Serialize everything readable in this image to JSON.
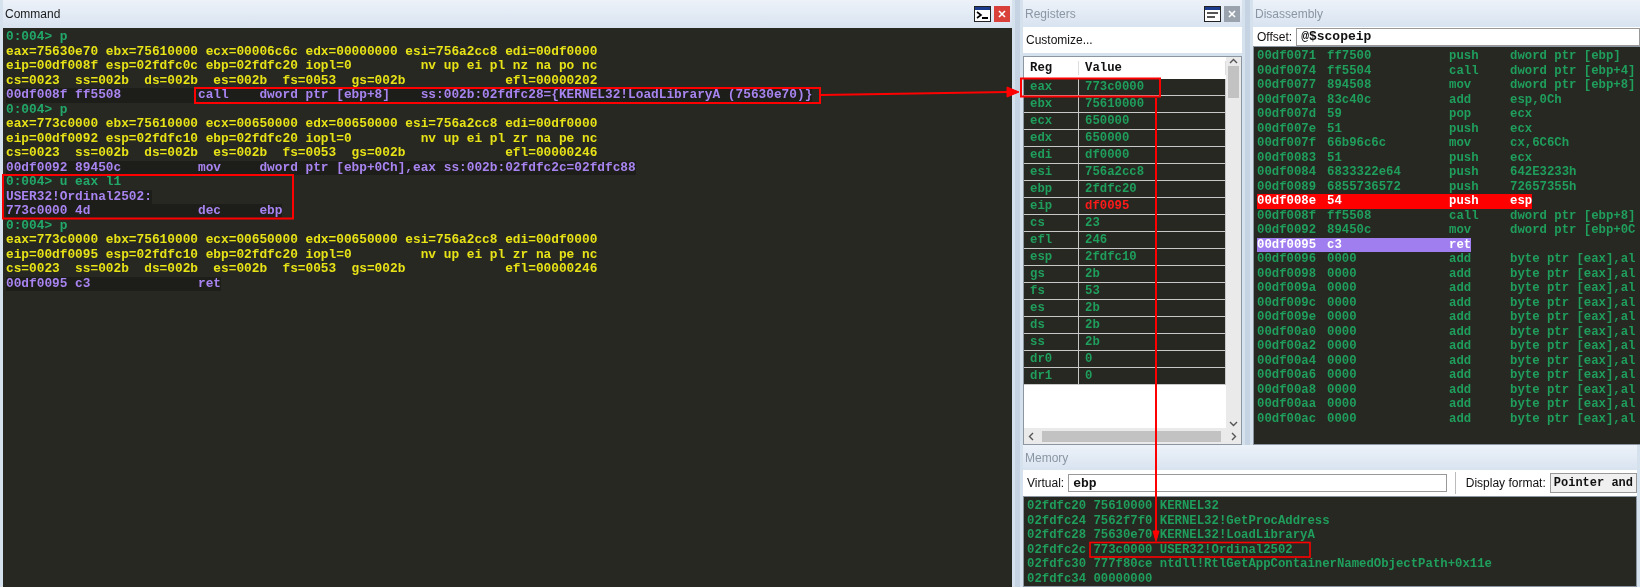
{
  "command": {
    "title": "Command",
    "lines": [
      {
        "kind": "prompt",
        "text": "0:004> p"
      },
      {
        "kind": "regs",
        "text": "eax=75630e70 ebx=75610000 ecx=00006c6c edx=00000000 esi=756a2cc8 edi=00df0000"
      },
      {
        "kind": "regs",
        "text": "eip=00df008f esp=02fdfc0c ebp=02fdfc20 iopl=0         nv up ei pl nz na po nc"
      },
      {
        "kind": "regs",
        "text": "cs=0023  ss=002b  ds=002b  es=002b  fs=0053  gs=002b             efl=00000202"
      },
      {
        "kind": "disasm",
        "text": "00df008f ff5508          call    dword ptr [ebp+8]    ss:002b:02fdfc28={KERNEL32!LoadLibraryA (75630e70)}"
      },
      {
        "kind": "prompt",
        "text": "0:004> p"
      },
      {
        "kind": "regs",
        "text": "eax=773c0000 ebx=75610000 ecx=00650000 edx=00650000 esi=756a2cc8 edi=00df0000"
      },
      {
        "kind": "regs",
        "text": "eip=00df0092 esp=02fdfc10 ebp=02fdfc20 iopl=0         nv up ei pl zr na pe nc"
      },
      {
        "kind": "regs",
        "text": "cs=0023  ss=002b  ds=002b  es=002b  fs=0053  gs=002b             efl=00000246"
      },
      {
        "kind": "disasm",
        "text": "00df0092 89450c          mov     dword ptr [ebp+0Ch],eax ss:002b:02fdfc2c=02fdfc88"
      },
      {
        "kind": "prompt",
        "text": "0:004> u eax l1"
      },
      {
        "kind": "symbol",
        "text": "USER32!Ordinal2502:"
      },
      {
        "kind": "disasm",
        "text": "773c0000 4d              dec     ebp"
      },
      {
        "kind": "prompt",
        "text": "0:004> p"
      },
      {
        "kind": "regs",
        "text": "eax=773c0000 ebx=75610000 ecx=00650000 edx=00650000 esi=756a2cc8 edi=00df0000"
      },
      {
        "kind": "regs",
        "text": "eip=00df0095 esp=02fdfc10 ebp=02fdfc20 iopl=0         nv up ei pl zr na pe nc"
      },
      {
        "kind": "regs",
        "text": "cs=0023  ss=002b  ds=002b  es=002b  fs=0053  gs=002b             efl=00000246"
      },
      {
        "kind": "disasm",
        "text": "00df0095 c3              ret"
      }
    ]
  },
  "registers": {
    "title": "Registers",
    "customize": "Customize...",
    "columns": [
      "Reg",
      "Value"
    ],
    "rows": [
      {
        "reg": "eax",
        "value": "773c0000",
        "changed": false
      },
      {
        "reg": "ebx",
        "value": "75610000",
        "changed": false
      },
      {
        "reg": "ecx",
        "value": "650000",
        "changed": false
      },
      {
        "reg": "edx",
        "value": "650000",
        "changed": false
      },
      {
        "reg": "edi",
        "value": "df0000",
        "changed": false
      },
      {
        "reg": "esi",
        "value": "756a2cc8",
        "changed": false
      },
      {
        "reg": "ebp",
        "value": "2fdfc20",
        "changed": false
      },
      {
        "reg": "eip",
        "value": "df0095",
        "changed": true
      },
      {
        "reg": "cs",
        "value": "23",
        "changed": false
      },
      {
        "reg": "efl",
        "value": "246",
        "changed": false
      },
      {
        "reg": "esp",
        "value": "2fdfc10",
        "changed": false
      },
      {
        "reg": "gs",
        "value": "2b",
        "changed": false
      },
      {
        "reg": "fs",
        "value": "53",
        "changed": false
      },
      {
        "reg": "es",
        "value": "2b",
        "changed": false
      },
      {
        "reg": "ds",
        "value": "2b",
        "changed": false
      },
      {
        "reg": "ss",
        "value": "2b",
        "changed": false
      },
      {
        "reg": "dr0",
        "value": "0",
        "changed": false
      },
      {
        "reg": "dr1",
        "value": "0",
        "changed": false
      }
    ]
  },
  "disassembly": {
    "title": "Disassembly",
    "offset_label": "Offset:",
    "offset": "@$scopeip",
    "rows": [
      {
        "address": "00df0071",
        "bytes": "ff7500",
        "mnemonic": "push",
        "operands": "dword ptr [ebp]",
        "breakpoint": false,
        "current": false
      },
      {
        "address": "00df0074",
        "bytes": "ff5504",
        "mnemonic": "call",
        "operands": "dword ptr [ebp+4]",
        "breakpoint": false,
        "current": false
      },
      {
        "address": "00df0077",
        "bytes": "894508",
        "mnemonic": "mov",
        "operands": "dword ptr [ebp+8]",
        "breakpoint": false,
        "current": false
      },
      {
        "address": "00df007a",
        "bytes": "83c40c",
        "mnemonic": "add",
        "operands": "esp,0Ch",
        "breakpoint": false,
        "current": false
      },
      {
        "address": "00df007d",
        "bytes": "59",
        "mnemonic": "pop",
        "operands": "ecx",
        "breakpoint": false,
        "current": false
      },
      {
        "address": "00df007e",
        "bytes": "51",
        "mnemonic": "push",
        "operands": "ecx",
        "breakpoint": false,
        "current": false
      },
      {
        "address": "00df007f",
        "bytes": "66b96c6c",
        "mnemonic": "mov",
        "operands": "cx,6C6Ch",
        "breakpoint": false,
        "current": false
      },
      {
        "address": "00df0083",
        "bytes": "51",
        "mnemonic": "push",
        "operands": "ecx",
        "breakpoint": false,
        "current": false
      },
      {
        "address": "00df0084",
        "bytes": "6833322e64",
        "mnemonic": "push",
        "operands": "642E3233h",
        "breakpoint": false,
        "current": false
      },
      {
        "address": "00df0089",
        "bytes": "6855736572",
        "mnemonic": "push",
        "operands": "72657355h",
        "breakpoint": false,
        "current": false
      },
      {
        "address": "00df008e",
        "bytes": "54",
        "mnemonic": "push",
        "operands": "esp",
        "breakpoint": true,
        "current": false
      },
      {
        "address": "00df008f",
        "bytes": "ff5508",
        "mnemonic": "call",
        "operands": "dword ptr [ebp+8]",
        "breakpoint": false,
        "current": false
      },
      {
        "address": "00df0092",
        "bytes": "89450c",
        "mnemonic": "mov",
        "operands": "dword ptr [ebp+0C",
        "breakpoint": false,
        "current": false
      },
      {
        "address": "00df0095",
        "bytes": "c3",
        "mnemonic": "ret",
        "breakpoint": false,
        "current": true
      },
      {
        "address": "00df0096",
        "bytes": "0000",
        "mnemonic": "add",
        "operands": "byte ptr [eax],al",
        "breakpoint": false,
        "current": false
      },
      {
        "address": "00df0098",
        "bytes": "0000",
        "mnemonic": "add",
        "operands": "byte ptr [eax],al",
        "breakpoint": false,
        "current": false
      },
      {
        "address": "00df009a",
        "bytes": "0000",
        "mnemonic": "add",
        "operands": "byte ptr [eax],al",
        "breakpoint": false,
        "current": false
      },
      {
        "address": "00df009c",
        "bytes": "0000",
        "mnemonic": "add",
        "operands": "byte ptr [eax],al",
        "breakpoint": false,
        "current": false
      },
      {
        "address": "00df009e",
        "bytes": "0000",
        "mnemonic": "add",
        "operands": "byte ptr [eax],al",
        "breakpoint": false,
        "current": false
      },
      {
        "address": "00df00a0",
        "bytes": "0000",
        "mnemonic": "add",
        "operands": "byte ptr [eax],al",
        "breakpoint": false,
        "current": false
      },
      {
        "address": "00df00a2",
        "bytes": "0000",
        "mnemonic": "add",
        "operands": "byte ptr [eax],al",
        "breakpoint": false,
        "current": false
      },
      {
        "address": "00df00a4",
        "bytes": "0000",
        "mnemonic": "add",
        "operands": "byte ptr [eax],al",
        "breakpoint": false,
        "current": false
      },
      {
        "address": "00df00a6",
        "bytes": "0000",
        "mnemonic": "add",
        "operands": "byte ptr [eax],al",
        "breakpoint": false,
        "current": false
      },
      {
        "address": "00df00a8",
        "bytes": "0000",
        "mnemonic": "add",
        "operands": "byte ptr [eax],al",
        "breakpoint": false,
        "current": false
      },
      {
        "address": "00df00aa",
        "bytes": "0000",
        "mnemonic": "add",
        "operands": "byte ptr [eax],al",
        "breakpoint": false,
        "current": false
      },
      {
        "address": "00df00ac",
        "bytes": "0000",
        "mnemonic": "add",
        "operands": "byte ptr [eax],al",
        "breakpoint": false,
        "current": false
      }
    ]
  },
  "memory": {
    "title": "Memory",
    "virtual_label": "Virtual:",
    "virtual": "ebp",
    "format_label": "Display format:",
    "format": "Pointer and",
    "lines": [
      {
        "address": "02fdfc20",
        "value": "75610000",
        "symbol": "KERNEL32"
      },
      {
        "address": "02fdfc24",
        "value": "7562f7f0",
        "symbol": "KERNEL32!GetProcAddress"
      },
      {
        "address": "02fdfc28",
        "value": "75630e70",
        "symbol": "KERNEL32!LoadLibraryA"
      },
      {
        "address": "02fdfc2c",
        "value": "773c0000",
        "symbol": "USER32!Ordinal2502"
      },
      {
        "address": "02fdfc30",
        "value": "777f80ce",
        "symbol": "ntdll!RtlGetAppContainerNamedObjectPath+0x11e"
      },
      {
        "address": "02fdfc34",
        "value": "00000000"
      }
    ]
  }
}
